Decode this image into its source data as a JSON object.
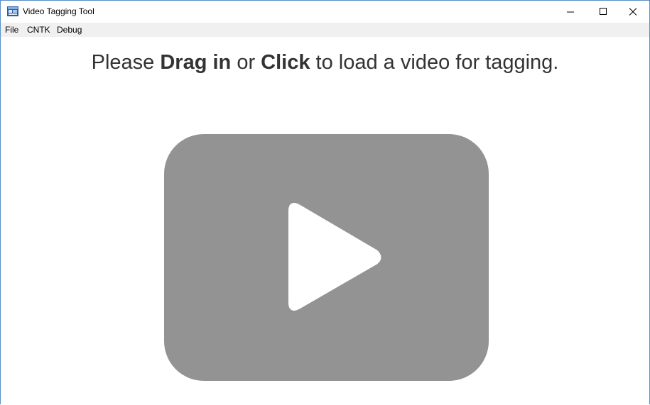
{
  "window": {
    "title": "Video Tagging Tool",
    "icon": "app-icon",
    "controls": {
      "minimize": "minimize-icon",
      "maximize": "maximize-icon",
      "close": "close-icon"
    }
  },
  "menu": {
    "items": [
      {
        "label": "File"
      },
      {
        "label": "CNTK"
      },
      {
        "label": "Debug"
      }
    ]
  },
  "main": {
    "prompt_part1": "Please ",
    "prompt_bold1": "Drag in",
    "prompt_part2": " or ",
    "prompt_bold2": "Click",
    "prompt_part3": " to load a video for tagging.",
    "dropzone_icon": "play-icon"
  },
  "colors": {
    "dropzone": "#939393",
    "play": "#ffffff",
    "text": "#333333",
    "menubar": "#f0f0f0",
    "border": "#5a8fc7"
  }
}
